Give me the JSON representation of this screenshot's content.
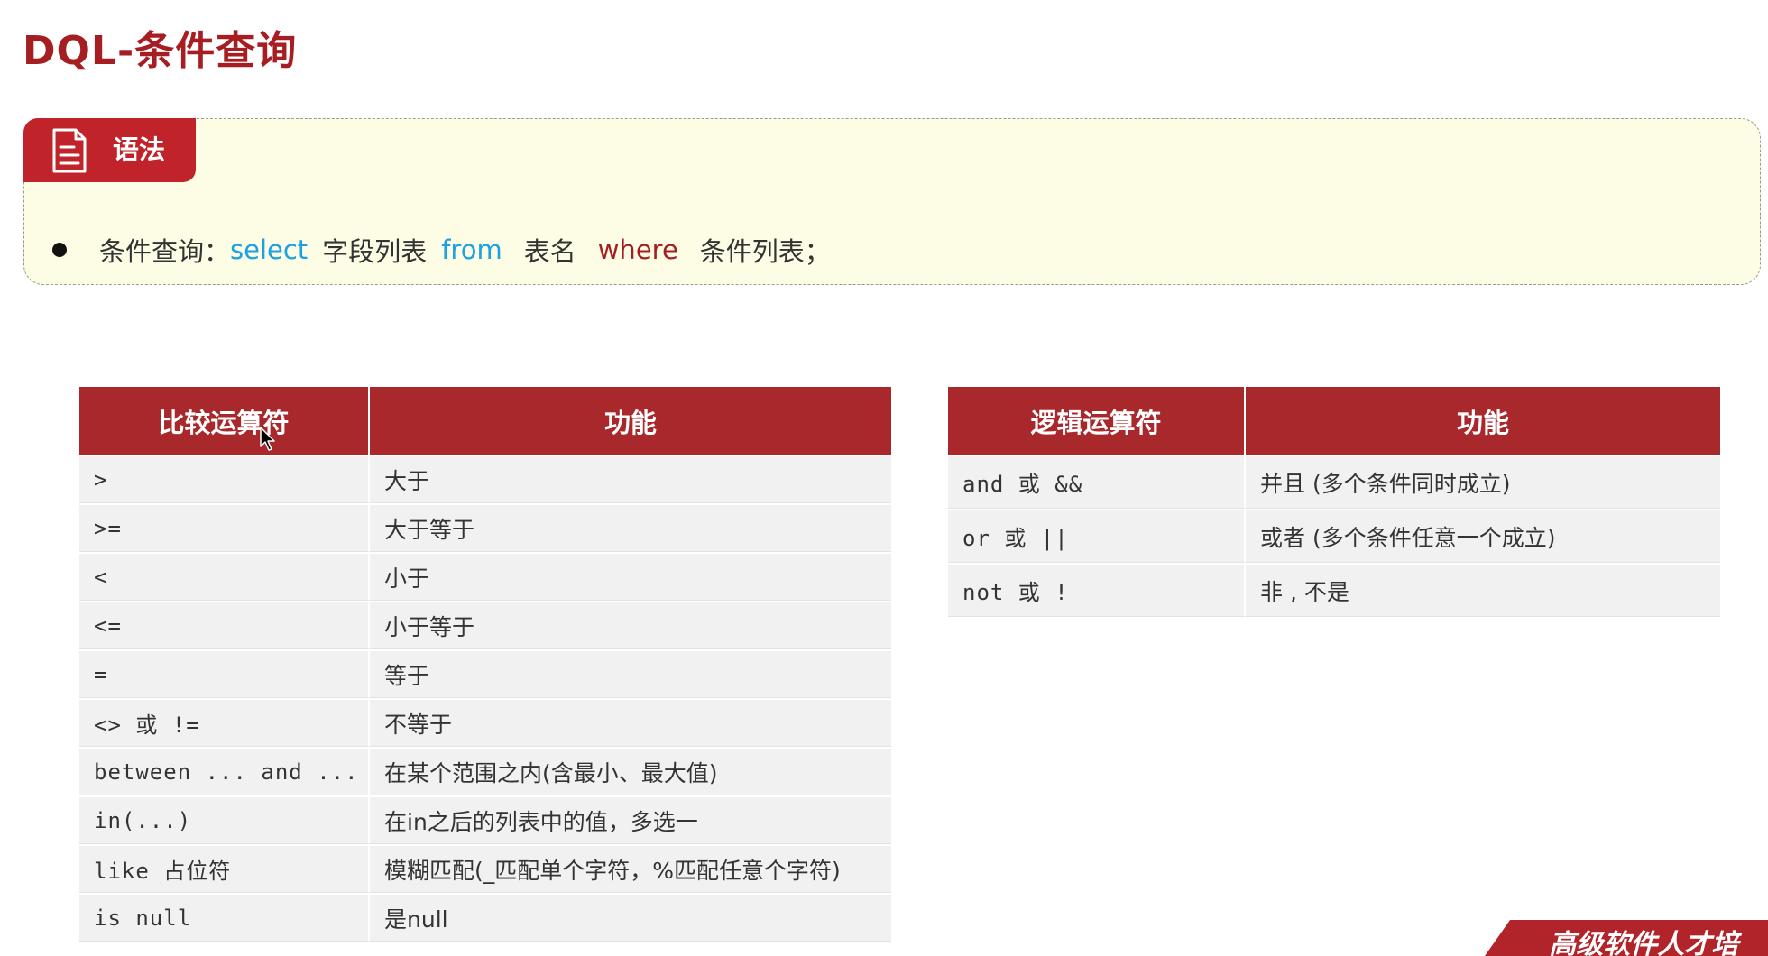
{
  "page": {
    "title": "DQL-条件查询"
  },
  "syntax": {
    "tab_label": "语法",
    "tab_icon": "document-icon",
    "line": {
      "prefix": "条件查询：",
      "kw_select": "select",
      "fields": "字段列表",
      "kw_from": "from",
      "table": "表名",
      "kw_where": "where",
      "conditions": "条件列表；"
    }
  },
  "comparison_table": {
    "headers": [
      "比较运算符",
      "功能"
    ],
    "rows": [
      [
        ">",
        "大于"
      ],
      [
        ">=",
        "大于等于"
      ],
      [
        "<",
        "小于"
      ],
      [
        "<=",
        "小于等于"
      ],
      [
        "=",
        "等于"
      ],
      [
        "<>  或 !=",
        "不等于"
      ],
      [
        "between ... and ...",
        "在某个范围之内(含最小、最大值)"
      ],
      [
        "in(...)",
        "在in之后的列表中的值，多选一"
      ],
      [
        "like  占位符",
        "模糊匹配(_匹配单个字符，%匹配任意个字符)"
      ],
      [
        "is null",
        "是null"
      ]
    ]
  },
  "logic_table": {
    "headers": [
      "逻辑运算符",
      "功能"
    ],
    "rows": [
      [
        "and  或  &&",
        "并且 (多个条件同时成立)"
      ],
      [
        "or  或  ||",
        "或者 (多个条件任意一个成立)"
      ],
      [
        "not  或  !",
        "非 , 不是"
      ]
    ]
  },
  "corner_banner": {
    "text": "高级软件人才培"
  },
  "colors": {
    "title_red": "#a61e22",
    "header_red": "#a8282b",
    "tab_red": "#c0232a",
    "keyword_blue": "#1ca1e2",
    "keyword_red": "#a61e22",
    "box_bg": "#fdfde6",
    "row_bg": "#f1f1f1"
  }
}
